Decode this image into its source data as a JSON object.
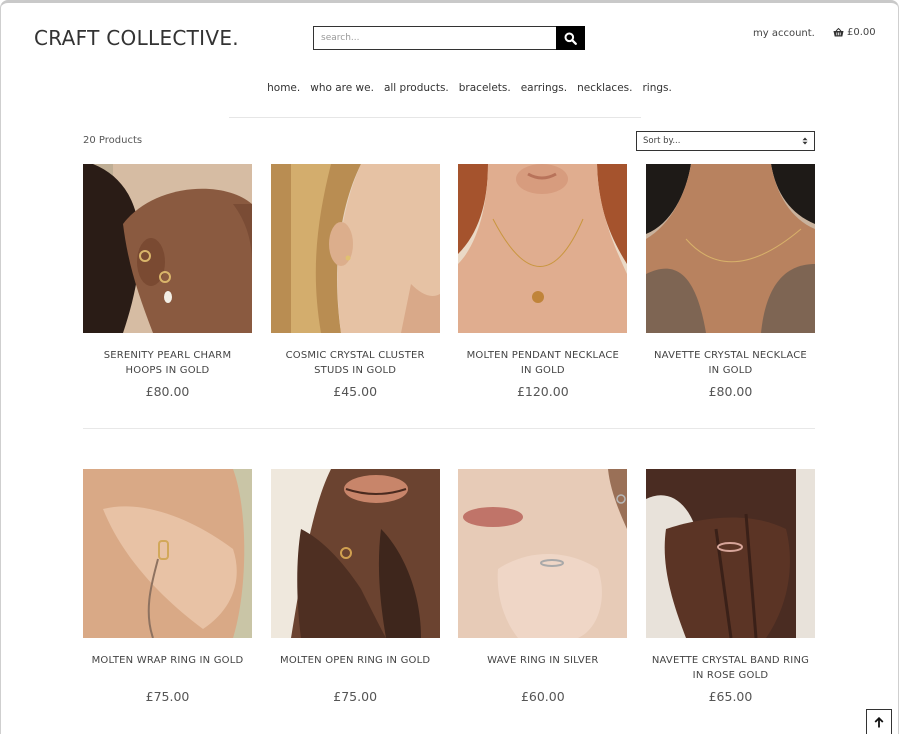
{
  "header": {
    "brand": "CRAFT COLLECTIVE.",
    "search_placeholder": "search...",
    "account_label": "my account.",
    "cart_total": "£0.00"
  },
  "nav": {
    "items": [
      "home.",
      "who are we.",
      "all products.",
      "bracelets.",
      "earrings.",
      "necklaces.",
      "rings."
    ]
  },
  "toolbar": {
    "product_count": "20 Products",
    "sort_selected": "Sort by..."
  },
  "products": [
    {
      "name": "SERENITY PEARL CHARM HOOPS IN GOLD",
      "price": "£80.00"
    },
    {
      "name": "COSMIC CRYSTAL CLUSTER STUDS IN GOLD",
      "price": "£45.00"
    },
    {
      "name": "MOLTEN PENDANT NECKLACE IN GOLD",
      "price": "£120.00"
    },
    {
      "name": "NAVETTE CRYSTAL NECKLACE IN GOLD",
      "price": "£80.00"
    },
    {
      "name": "MOLTEN WRAP RING IN GOLD",
      "price": "£75.00"
    },
    {
      "name": "MOLTEN OPEN RING IN GOLD",
      "price": "£75.00"
    },
    {
      "name": "WAVE RING IN SILVER",
      "price": "£60.00"
    },
    {
      "name": "NAVETTE CRYSTAL BAND RING IN ROSE GOLD",
      "price": "£65.00"
    }
  ],
  "icons": {
    "search": "search-icon",
    "cart": "basket-icon",
    "sort": "sort-arrows-icon",
    "back_to_top": "arrow-up-icon"
  }
}
